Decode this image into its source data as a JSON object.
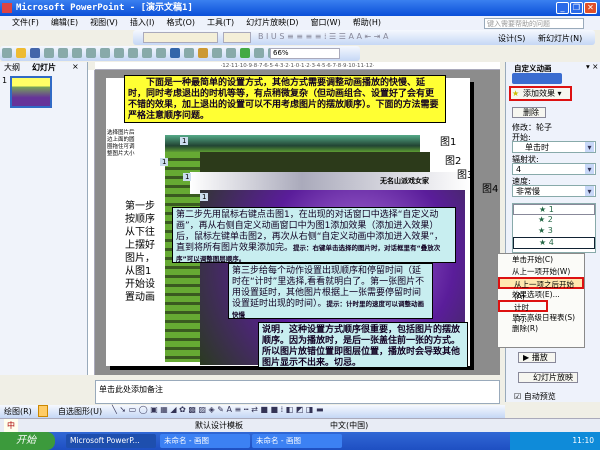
{
  "window": {
    "title": "Microsoft PowerPoint - [演示文稿1]"
  },
  "menu": [
    "文件(F)",
    "编辑(E)",
    "视图(V)",
    "插入(I)",
    "格式(O)",
    "工具(T)",
    "幻灯片放映(D)",
    "窗口(W)",
    "帮助(H)"
  ],
  "help_placeholder": "键入需要帮助的问题",
  "toolbar": {
    "design": "设计(S)",
    "new_slide": "新幻灯片(N)",
    "zoom": "66%"
  },
  "left_tabs": [
    "大纲",
    "幻灯片"
  ],
  "thumbnail_number": "1",
  "slide": {
    "intro": "下面是一种最简单的设置方式，其他方式需要调整动画播放的快慢、延时，同时考虑退出的时机等等，有点稍微复杂（但动画组合、设置好了会有更不错的效果，加上退出的设置可以不用考虑图片的摆放顺序）。下面的方法需要严格注意顺序问题。",
    "side_hint": "选择图片后边上面的圆圈拖住可调整图片大小",
    "step1": "第一步按顺序从下往上摆好图片，从图1开始设置动画",
    "step2": "第二步先用鼠标右键点击图1，在出现的对话窗口中选择“自定义动画”，再从右侧自定义动画窗口中为图1添加效果（添加进入效果）后，鼠标左键单击图2，再次从右侧“自定义动画中添加进入效果”，直到将所有图片效果添加完。",
    "step2_tip": "提示：右键单击选择的图片时，对话框里有“叠放次序”可以调整图层顺序。",
    "step3": "第三步给每个动作设置出现顺序和停留时间（延时在“计时”里选择,看看就明白了。第一张图片不用设置延时，其他图片根据上一张需要停留时间设置延时出现的时间）。",
    "step3_tip": "提示：计时里的速度可以调整动画快慢",
    "explain": "说明，这种设置方式顺序很重要，包括图片的摆放顺序。因为播放时，是后一张盖住前一张的方式。所以图片放错位置即图层位置，播放时会导致其他图片显示不出来。切忌。",
    "labels": [
      "图1",
      "图2",
      "图3",
      "图4"
    ],
    "calligraphy": "无名山派戏女家",
    "badge": "1"
  },
  "notes_placeholder": "单击此处添加备注",
  "pane": {
    "title": "自定义动画",
    "add_effect": "添加效果",
    "remove": "删除",
    "modify": "修改：轮子",
    "start_label": "开始:",
    "start_value": "单击时",
    "spokes_label": "辐射状:",
    "spokes_value": "4",
    "speed_label": "速度:",
    "speed_value": "非常慢",
    "list": [
      "1",
      "2",
      "3",
      "4"
    ],
    "play": "播放",
    "slideshow": "幻灯片放映",
    "autopreview": "自动预览"
  },
  "context_menu": [
    "单击开始(C)",
    "从上一项开始(W)",
    "从上一项之后开始(A)",
    "效果选项(E)...",
    "计时(T)...",
    "显示高级日程表(S)",
    "删除(R)"
  ],
  "drawbar": {
    "draw": "绘图(R)",
    "autoshapes": "自选图形(U)"
  },
  "status": {
    "template": "默认设计模板",
    "language": "中文(中国)"
  },
  "taskbar": {
    "start": "开始",
    "tasks": [
      "Microsoft PowerP...",
      "未命名 - 画图",
      "未命名 - 画图"
    ],
    "clock": "11:10",
    "ime": "中"
  },
  "colors": {
    "yellow": "#ffff33",
    "cyan": "#c8eef0",
    "highlight": "#d11"
  }
}
